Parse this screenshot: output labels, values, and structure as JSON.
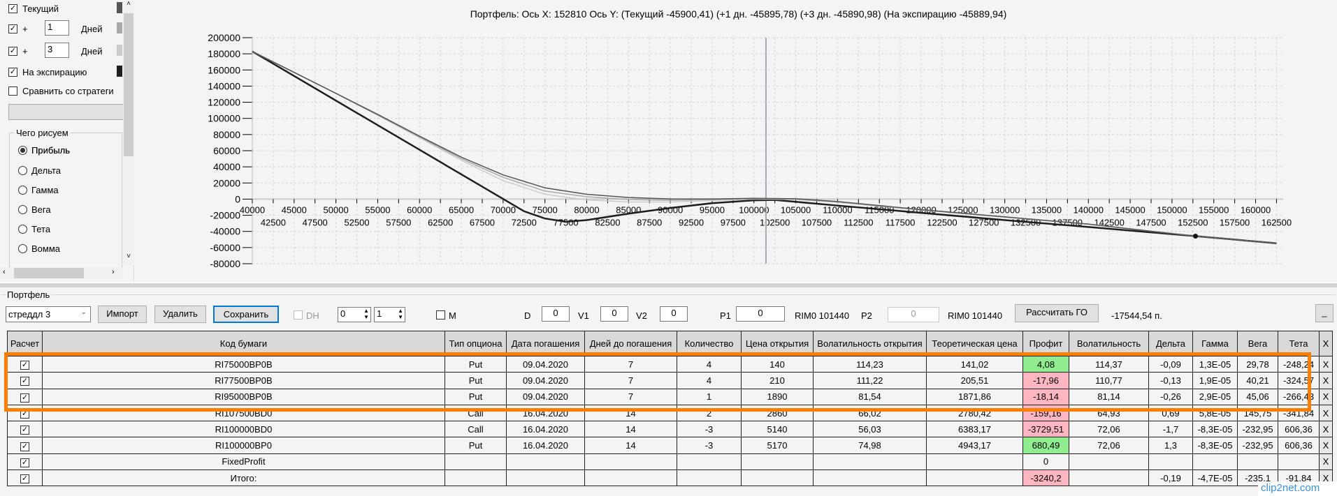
{
  "left_panel": {
    "current_label": "Текущий",
    "plus_label": "+",
    "days_label": "Дней",
    "plus1_value": "1",
    "plus3_value": "3",
    "expiration_label": "На экспирацию",
    "compare_label": "Сравнить со стратеги",
    "group_title": "Чего рисуем",
    "radios": [
      "Прибыль",
      "Дельта",
      "Гамма",
      "Вега",
      "Тета",
      "Вомма"
    ],
    "selected_radio": "Прибыль",
    "colors": {
      "current": "#555555",
      "plus1": "#aaaaaa",
      "plus3": "#cccccc",
      "expiration": "#1e1e1e"
    }
  },
  "chart_title": "Портфель: Ось X: 152810 Ось Y:  (Текущий -45900,41)  (+1 дн. -45895,78)  (+3 дн. -45890,98)  (На экспирацию -45889,94)",
  "chart_data": {
    "type": "line",
    "xlim": [
      40000,
      163300
    ],
    "ylim": [
      -80000,
      200000
    ],
    "yticks": [
      200000,
      180000,
      160000,
      140000,
      120000,
      100000,
      80000,
      60000,
      40000,
      20000,
      0,
      -20000,
      -40000,
      -60000,
      -80000
    ],
    "xticks_top": [
      40000,
      45000,
      50000,
      55000,
      60000,
      65000,
      70000,
      75000,
      80000,
      85000,
      90000,
      95000,
      100000,
      105000,
      110000,
      115000,
      120000,
      125000,
      130000,
      135000,
      140000,
      145000,
      150000,
      155000,
      160000
    ],
    "xticks_bottom": [
      42500,
      47500,
      52500,
      57500,
      62500,
      67500,
      72500,
      77500,
      82500,
      87500,
      92500,
      97500,
      102500,
      107500,
      112500,
      117500,
      122500,
      127500,
      132500,
      137500,
      142500,
      147500,
      152500,
      157500,
      162500
    ],
    "cursor_x": 101440,
    "marker": {
      "x": 152810,
      "y": -45890
    },
    "series": [
      {
        "name": "Текущий",
        "color": "#555555",
        "points": [
          [
            40000,
            183000
          ],
          [
            50000,
            131000
          ],
          [
            55000,
            105000
          ],
          [
            60000,
            78000
          ],
          [
            65000,
            52000
          ],
          [
            70000,
            30000
          ],
          [
            75000,
            14000
          ],
          [
            80000,
            6000
          ],
          [
            85000,
            2000
          ],
          [
            90000,
            300
          ],
          [
            95000,
            200
          ],
          [
            100000,
            1000
          ],
          [
            105000,
            500
          ],
          [
            110000,
            -3000
          ],
          [
            120000,
            -13000
          ],
          [
            130000,
            -22000
          ],
          [
            140000,
            -31000
          ],
          [
            152810,
            -45900
          ],
          [
            162500,
            -54700
          ]
        ]
      },
      {
        "name": "+1 дн.",
        "color": "#aaaaaa",
        "points": [
          [
            40000,
            183000
          ],
          [
            50000,
            131000
          ],
          [
            55000,
            104000
          ],
          [
            60000,
            77000
          ],
          [
            65000,
            50000
          ],
          [
            70000,
            27000
          ],
          [
            75000,
            10000
          ],
          [
            80000,
            3000
          ],
          [
            85000,
            -500
          ],
          [
            90000,
            -1500
          ],
          [
            95000,
            -700
          ],
          [
            100000,
            500
          ],
          [
            105000,
            0
          ],
          [
            110000,
            -3500
          ],
          [
            120000,
            -13500
          ],
          [
            130000,
            -22000
          ],
          [
            140000,
            -31000
          ],
          [
            152810,
            -45896
          ],
          [
            162500,
            -54700
          ]
        ]
      },
      {
        "name": "+3 дн.",
        "color": "#cccccc",
        "points": [
          [
            40000,
            183000
          ],
          [
            50000,
            131000
          ],
          [
            55000,
            104000
          ],
          [
            60000,
            76000
          ],
          [
            65000,
            48000
          ],
          [
            70000,
            23000
          ],
          [
            75000,
            6000
          ],
          [
            80000,
            -1000
          ],
          [
            85000,
            -3500
          ],
          [
            90000,
            -3500
          ],
          [
            95000,
            -1800
          ],
          [
            100000,
            0
          ],
          [
            105000,
            -500
          ],
          [
            110000,
            -4000
          ],
          [
            120000,
            -13500
          ],
          [
            130000,
            -22500
          ],
          [
            140000,
            -31000
          ],
          [
            152810,
            -45891
          ],
          [
            162500,
            -54700
          ]
        ]
      },
      {
        "name": "На экспирацию",
        "color": "#1e1e1e",
        "points": [
          [
            40000,
            183000
          ],
          [
            72500,
            -15000
          ],
          [
            75000,
            -24000
          ],
          [
            77500,
            -28000
          ],
          [
            80000,
            -26000
          ],
          [
            85000,
            -18000
          ],
          [
            90000,
            -11000
          ],
          [
            95000,
            -5000
          ],
          [
            100000,
            -1500
          ],
          [
            102500,
            -1000
          ],
          [
            110000,
            -8000
          ],
          [
            120000,
            -17000
          ],
          [
            130000,
            -26000
          ],
          [
            140000,
            -34500
          ],
          [
            152810,
            -45890
          ],
          [
            162500,
            -54700
          ]
        ]
      }
    ]
  },
  "portfolio": {
    "group_title": "Портфель",
    "strategy_select": "стреддл 3",
    "import_label": "Импорт",
    "delete_label": "Удалить",
    "save_label": "Сохранить",
    "dh_label": "DH",
    "spin1": "0",
    "spin2": "1",
    "m_label": "M",
    "d_label": "D",
    "d_value": "0",
    "v1_label": "V1",
    "v1_value": "0",
    "v2_label": "V2",
    "v2_value": "0",
    "p1_label": "P1",
    "p1_value": "0",
    "rim1": "RIM0 101440",
    "p2_label": "P2",
    "p2_value": "0",
    "rim2": "RIM0 101440",
    "calc_go_label": "Рассчитать ГО",
    "go_value": "-17544,54 п.",
    "minimize_label": "_"
  },
  "table": {
    "headers": [
      "Расчет",
      "Код бумаги",
      "Тип опциона",
      "Дата погашения",
      "Дней до погашения",
      "Количество",
      "Цена открытия",
      "Волатильность открытия",
      "Теоретическая цена",
      "Профит",
      "Волатильность",
      "Дельта",
      "Гамма",
      "Вега",
      "Тета",
      "X"
    ],
    "rows": [
      {
        "code": "RI75000BP0B",
        "type": "Put",
        "date": "09.04.2020",
        "days": "7",
        "qty": "4",
        "price": "140",
        "vol_open": "114,23",
        "theor": "141,02",
        "profit": "4,08",
        "profit_state": "pos",
        "vol": "114,37",
        "delta": "-0,09",
        "gamma": "1,3E-05",
        "vega": "29,78",
        "theta": "-248,24",
        "x": "X"
      },
      {
        "code": "RI77500BP0B",
        "type": "Put",
        "date": "09.04.2020",
        "days": "7",
        "qty": "4",
        "price": "210",
        "vol_open": "111,22",
        "theor": "205,51",
        "profit": "-17,96",
        "profit_state": "neg",
        "vol": "110,77",
        "delta": "-0,13",
        "gamma": "1,9E-05",
        "vega": "40,21",
        "theta": "-324,57",
        "x": "X"
      },
      {
        "code": "RI95000BP0B",
        "type": "Put",
        "date": "09.04.2020",
        "days": "7",
        "qty": "1",
        "price": "1890",
        "vol_open": "81,54",
        "theor": "1871,86",
        "profit": "-18,14",
        "profit_state": "neg",
        "vol": "81,14",
        "delta": "-0,26",
        "gamma": "2,9E-05",
        "vega": "45,06",
        "theta": "-266,43",
        "x": "X"
      },
      {
        "code": "RI107500BD0",
        "type": "Call",
        "date": "16.04.2020",
        "days": "14",
        "qty": "2",
        "price": "2860",
        "vol_open": "66,02",
        "theor": "2780,42",
        "profit": "-159,16",
        "profit_state": "neg",
        "vol": "64,93",
        "delta": "0,69",
        "gamma": "5,8E-05",
        "vega": "145,75",
        "theta": "-341,84",
        "x": "X"
      },
      {
        "code": "RI100000BD0",
        "type": "Call",
        "date": "16.04.2020",
        "days": "14",
        "qty": "-3",
        "price": "5140",
        "vol_open": "56,03",
        "theor": "6383,17",
        "profit": "-3729,51",
        "profit_state": "neg",
        "vol": "72,06",
        "delta": "-1,7",
        "gamma": "-8,3E-05",
        "vega": "-232,95",
        "theta": "606,36",
        "x": "X"
      },
      {
        "code": "RI100000BP0",
        "type": "Put",
        "date": "16.04.2020",
        "days": "14",
        "qty": "-3",
        "price": "5170",
        "vol_open": "74,98",
        "theor": "4943,17",
        "profit": "680,49",
        "profit_state": "pos",
        "vol": "72,06",
        "delta": "1,3",
        "gamma": "-8,3E-05",
        "vega": "-232,95",
        "theta": "606,36",
        "x": "X"
      },
      {
        "code": "FixedProfit",
        "type": "",
        "date": "",
        "days": "",
        "qty": "",
        "price": "",
        "vol_open": "",
        "theor": "",
        "profit": "0",
        "profit_state": "",
        "vol": "",
        "delta": "",
        "gamma": "",
        "vega": "",
        "theta": "",
        "x": "X"
      },
      {
        "code": "Итого:",
        "type": "",
        "date": "",
        "days": "",
        "qty": "",
        "price": "",
        "vol_open": "",
        "theor": "",
        "profit": "-3240,2",
        "profit_state": "neg",
        "vol": "",
        "delta": "-0,19",
        "gamma": "-4,7E-05",
        "vega": "-235,1",
        "theta": "-91,84",
        "x": "X"
      }
    ]
  },
  "watermark": "clip2net.com"
}
